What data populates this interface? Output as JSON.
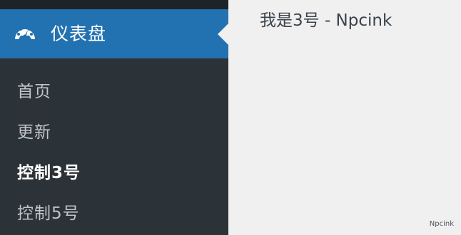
{
  "sidebar": {
    "active_menu": {
      "icon": "dashboard-gauge-icon",
      "label": "仪表盘"
    },
    "submenu": [
      {
        "label": "首页",
        "current": false
      },
      {
        "label": "更新",
        "current": false
      },
      {
        "label": "控制3号",
        "current": true
      },
      {
        "label": "控制5号",
        "current": false
      }
    ]
  },
  "main": {
    "title": "我是3号 - Npcink"
  },
  "footer": {
    "credit": "Npcink"
  },
  "colors": {
    "sidebar_bg": "#2c3338",
    "active_menu_bg": "#2271b1",
    "content_bg": "#f0f0f1"
  }
}
